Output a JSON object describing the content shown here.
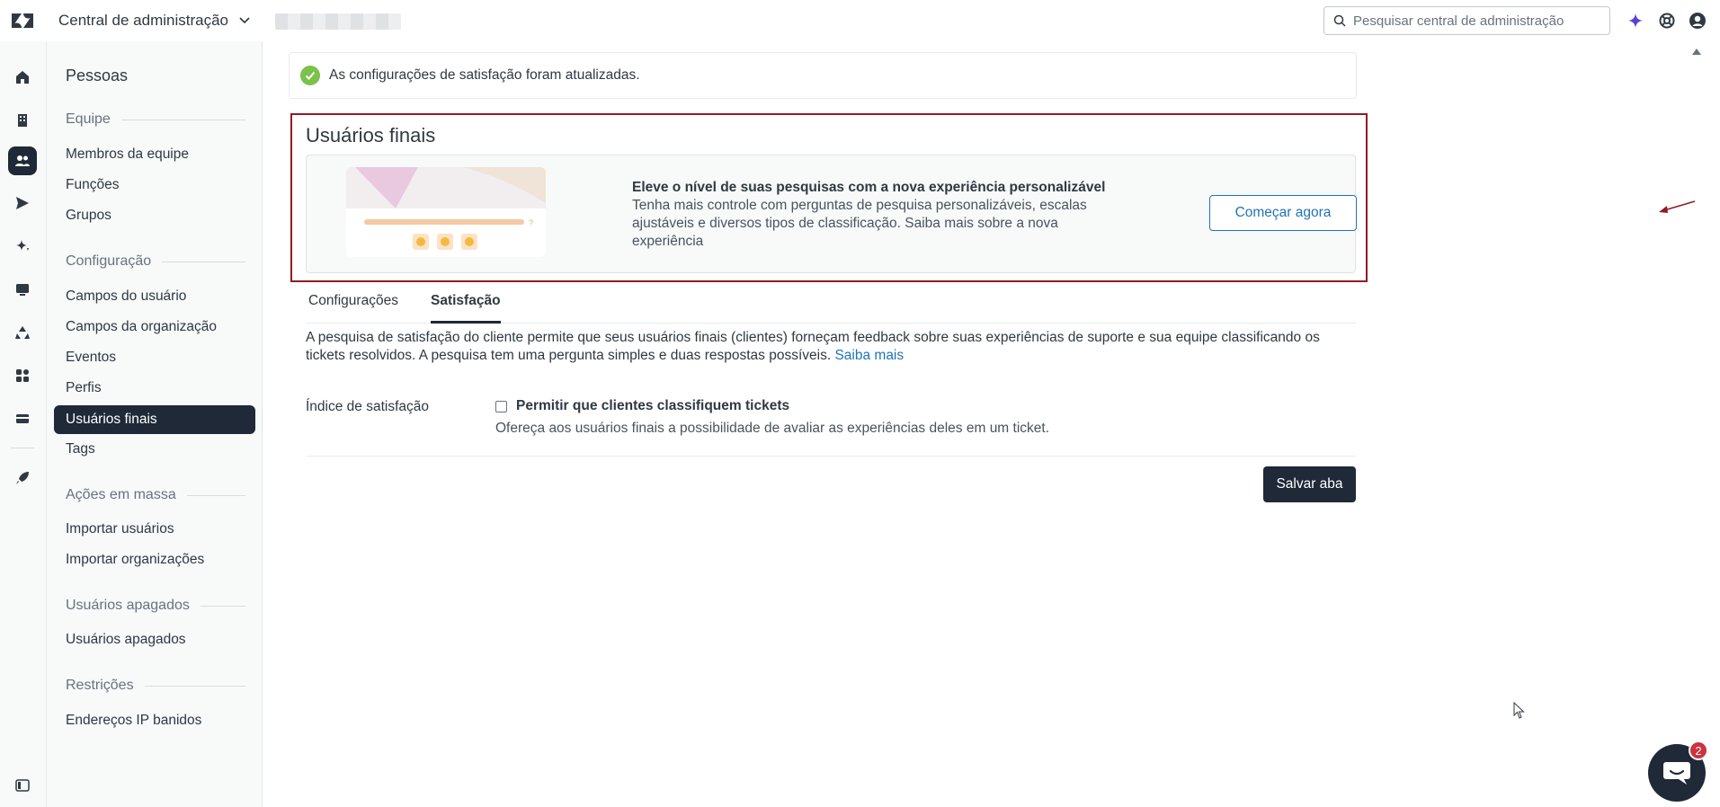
{
  "header": {
    "app_title": "Central de administração",
    "search_placeholder": "Pesquisar central de administração"
  },
  "sidebar": {
    "title": "Pessoas",
    "sections": [
      {
        "heading": "Equipe",
        "items": [
          "Membros da equipe",
          "Funções",
          "Grupos"
        ]
      },
      {
        "heading": "Configuração",
        "items": [
          "Campos do usuário",
          "Campos da organização",
          "Eventos",
          "Perfis",
          "Usuários finais",
          "Tags"
        ]
      },
      {
        "heading": "Ações em massa",
        "items": [
          "Importar usuários",
          "Importar organizações"
        ]
      },
      {
        "heading": "Usuários apagados",
        "items": [
          "Usuários apagados"
        ]
      },
      {
        "heading": "Restrições",
        "items": [
          "Endereços IP banidos"
        ]
      }
    ],
    "active_item": "Usuários finais"
  },
  "main": {
    "toast": "As configurações de satisfação foram atualizadas.",
    "page_title": "Usuários finais",
    "promo": {
      "heading": "Eleve o nível de suas pesquisas com a nova experiência personalizável",
      "body": "Tenha mais controle com perguntas de pesquisa personalizáveis, escalas ajustáveis e diversos tipos de classificação. Saiba mais sobre a nova experiência",
      "button": "Começar agora",
      "image_question_mark": "?"
    },
    "tabs": [
      {
        "label": "Configurações",
        "selected": false
      },
      {
        "label": "Satisfação",
        "selected": true
      }
    ],
    "description": "A pesquisa de satisfação do cliente permite que seus usuários finais (clientes) forneçam feedback sobre suas experiências de suporte e sua equipe classificando os tickets resolvidos. A pesquisa tem uma pergunta simples e duas respostas possíveis.",
    "description_link": "Saiba mais",
    "field_label": "Índice de satisfação",
    "checkbox_label": "Permitir que clientes classifiquem tickets",
    "checkbox_checked": false,
    "checkbox_hint": "Ofereça aos usuários finais a possibilidade de avaliar as experiências deles em um ticket.",
    "save_button": "Salvar aba"
  },
  "chat": {
    "badge_count": "2"
  },
  "colors": {
    "accent": "#1f73b7",
    "dark": "#1f2937",
    "highlight_border": "#8f1c23",
    "success": "#7bc24a",
    "badge": "#cc3340"
  }
}
